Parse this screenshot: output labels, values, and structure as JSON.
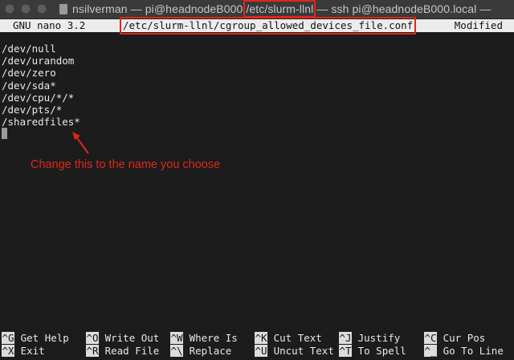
{
  "window": {
    "title_part1": "nsilverman — pi@headnodeB000 ",
    "title_highlight": "/etc/slurm-llnl",
    "title_part2": " — ssh pi@headnodeB000.local —"
  },
  "nano": {
    "version": "GNU nano 3.2",
    "filename": "/etc/slurm-llnl/cgroup_allowed_devices_file.conf",
    "status": "Modified"
  },
  "editor": {
    "lines": [
      "/dev/null",
      "/dev/urandom",
      "/dev/zero",
      "/dev/sda*",
      "/dev/cpu/*/*",
      "/dev/pts/*",
      "/sharedfiles*"
    ]
  },
  "annotation": {
    "text": "Change this to the name you choose",
    "color": "#e0261b"
  },
  "shortcuts": {
    "row1": [
      {
        "key": "^G",
        "label": "Get Help"
      },
      {
        "key": "^O",
        "label": "Write Out"
      },
      {
        "key": "^W",
        "label": "Where Is"
      },
      {
        "key": "^K",
        "label": "Cut Text"
      },
      {
        "key": "^J",
        "label": "Justify"
      },
      {
        "key": "^C",
        "label": "Cur Pos"
      }
    ],
    "row2": [
      {
        "key": "^X",
        "label": "Exit"
      },
      {
        "key": "^R",
        "label": "Read File"
      },
      {
        "key": "^\\",
        "label": "Replace"
      },
      {
        "key": "^U",
        "label": "Uncut Text"
      },
      {
        "key": "^T",
        "label": "To Spell"
      },
      {
        "key": "^_",
        "label": "Go To Line"
      }
    ]
  }
}
